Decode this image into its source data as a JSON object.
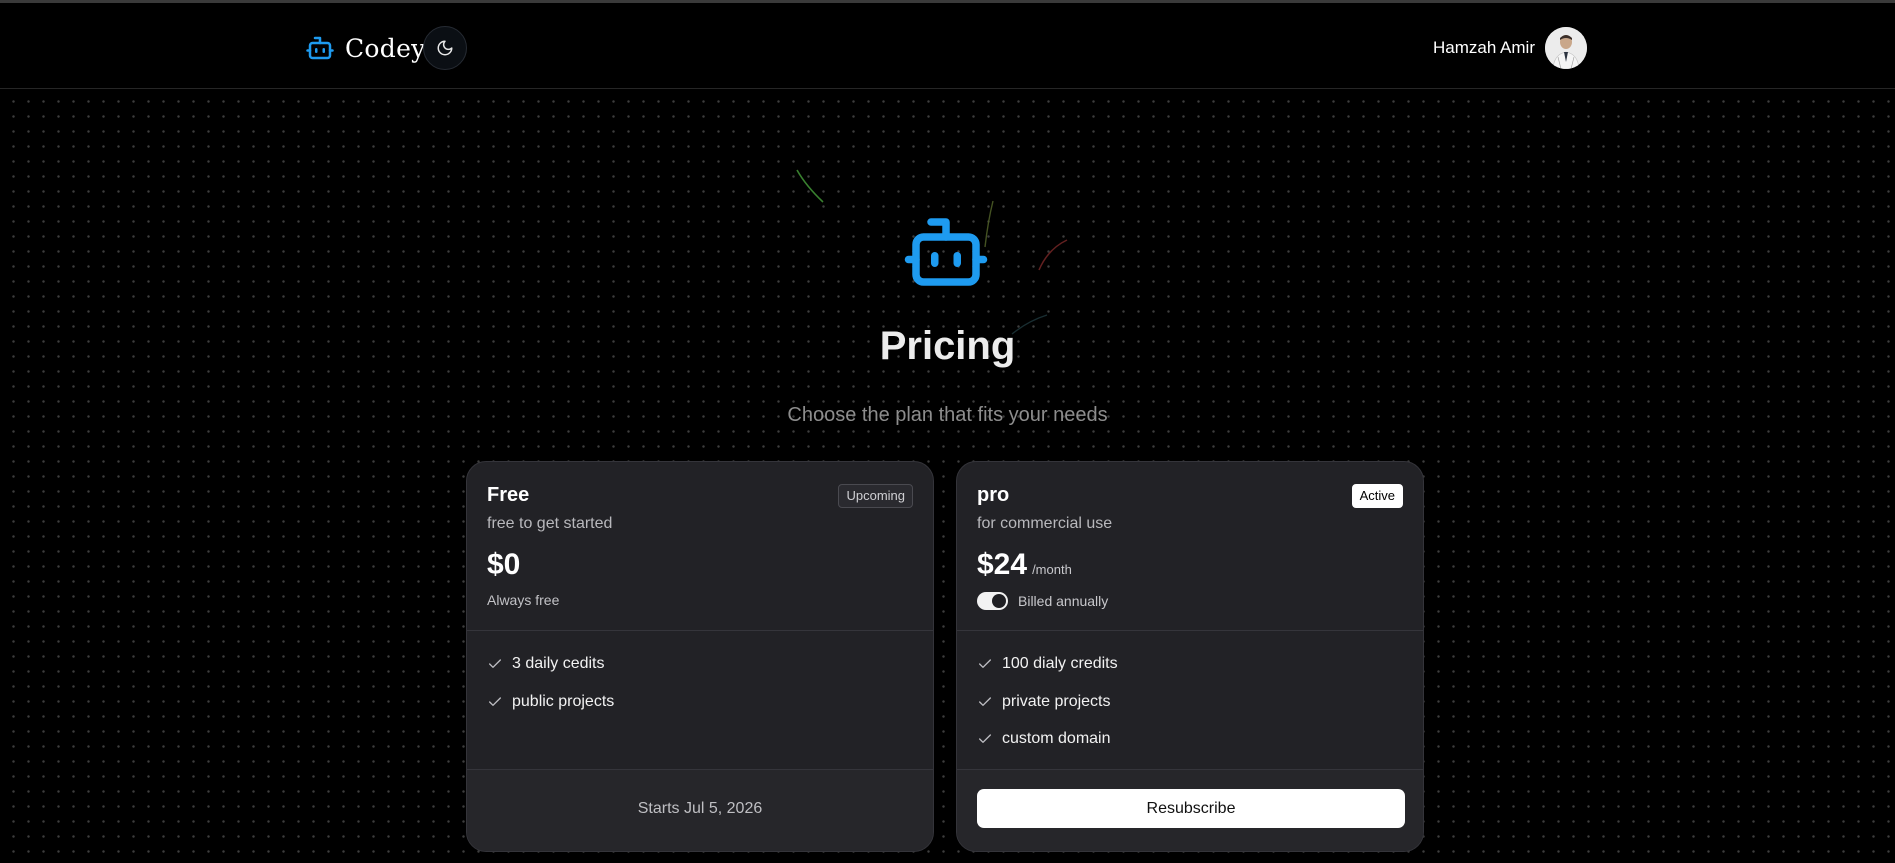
{
  "header": {
    "brand_name": "Codey",
    "brand_icon": "bot-icon",
    "theme_toggle_icon": "moon-icon",
    "user_name": "Hamzah Amir"
  },
  "hero": {
    "icon": "bot-icon",
    "title": "Pricing",
    "subtitle": "Choose the plan that fits your needs"
  },
  "plans": [
    {
      "name": "Free",
      "description": "free to get started",
      "badge": "Upcoming",
      "price": "$0",
      "price_note": "Always free",
      "features": [
        "3 daily cedits",
        "public projects"
      ],
      "footer_text": "Starts Jul 5, 2026"
    },
    {
      "name": "pro",
      "description": "for commercial use",
      "badge": "Active",
      "price": "$24",
      "price_period": "/month",
      "billing_label": "Billed annually",
      "billing_annual": true,
      "features": [
        "100 dialy credits",
        "private projects",
        "custom domain"
      ],
      "button_label": "Resubscribe"
    }
  ],
  "colors": {
    "accent": "#1e9bf0",
    "background": "#000000",
    "card": "#222226"
  }
}
